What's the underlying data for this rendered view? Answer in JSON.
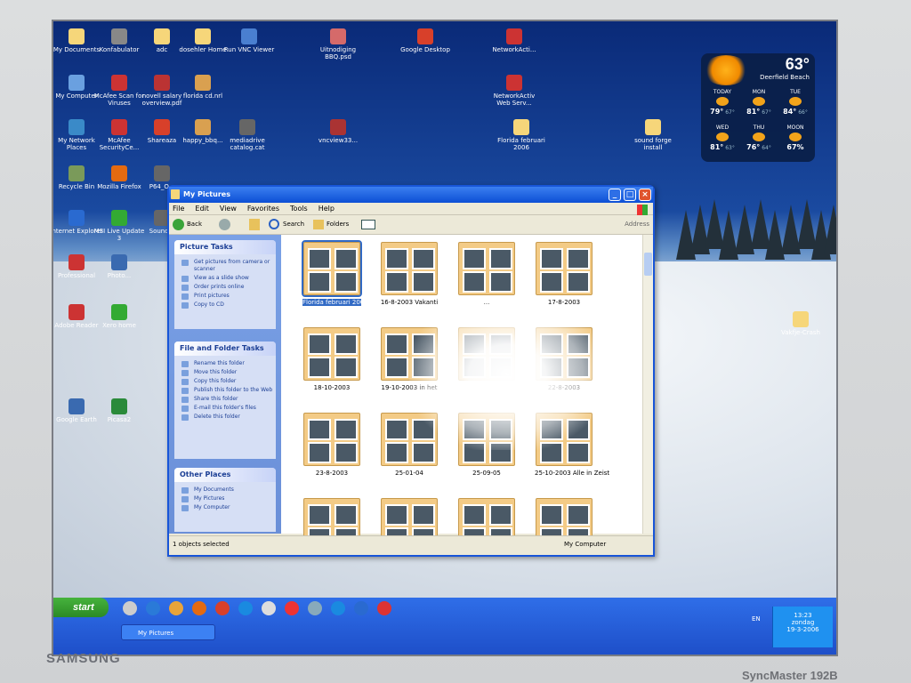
{
  "monitor": {
    "brand": "SAMSUNG",
    "model": "SyncMaster 192B"
  },
  "desktop_icons": [
    {
      "label": "My Documents"
    },
    {
      "label": "Konfabulator"
    },
    {
      "label": "adc"
    },
    {
      "label": "dosehler Home"
    },
    {
      "label": "Run VNC Viewer"
    },
    {
      "label": "Uitnodiging BBQ.psd"
    },
    {
      "label": "Google Desktop"
    },
    {
      "label": "NetworkActi..."
    },
    {
      "label": "My Computer"
    },
    {
      "label": "McAfee Scan for Viruses"
    },
    {
      "label": "novell salary overview.pdf"
    },
    {
      "label": "florida cd.nrl"
    },
    {
      "label": "NetworkActiv Web Serv..."
    },
    {
      "label": "My Network Places"
    },
    {
      "label": "McAfee SecurityCe..."
    },
    {
      "label": "Shareaza"
    },
    {
      "label": "happy_bbq..."
    },
    {
      "label": "mediadrive catalog.cat"
    },
    {
      "label": "vncview33..."
    },
    {
      "label": "Florida februari 2006"
    },
    {
      "label": "sound forge install"
    },
    {
      "label": "Recycle Bin"
    },
    {
      "label": "Mozilla Firefox"
    },
    {
      "label": "P64_O..."
    },
    {
      "label": "Internet Explorer"
    },
    {
      "label": "MSI Live Update 3"
    },
    {
      "label": "Sound..."
    },
    {
      "label": "Professional"
    },
    {
      "label": "Photo..."
    },
    {
      "label": "Adobe Reader"
    },
    {
      "label": "Xero home"
    },
    {
      "label": "Google Earth"
    },
    {
      "label": "Picasa2"
    },
    {
      "label": "Vakfje-Crash"
    }
  ],
  "weather": {
    "temp": "63°",
    "location": "Deerfield Beach",
    "days": [
      {
        "name": "TODAY",
        "hi": "79°",
        "lo": "67°"
      },
      {
        "name": "MON",
        "hi": "81°",
        "lo": "67°"
      },
      {
        "name": "TUE",
        "hi": "84°",
        "lo": "66°"
      },
      {
        "name": "WED",
        "hi": "81°",
        "lo": "63°"
      },
      {
        "name": "THU",
        "hi": "76°",
        "lo": "64°"
      },
      {
        "name": "MOON",
        "hi": "67%",
        "lo": ""
      }
    ]
  },
  "window": {
    "title": "My Pictures",
    "menu": [
      "File",
      "Edit",
      "View",
      "Favorites",
      "Tools",
      "Help"
    ],
    "toolbar": {
      "back": "Back",
      "search": "Search",
      "folders": "Folders",
      "address": "Address"
    },
    "picture_tasks": {
      "title": "Picture Tasks",
      "items": [
        "Get pictures from camera or scanner",
        "View as a slide show",
        "Order prints online",
        "Print pictures",
        "Copy to CD"
      ]
    },
    "file_tasks": {
      "title": "File and Folder Tasks",
      "items": [
        "Rename this folder",
        "Move this folder",
        "Copy this folder",
        "Publish this folder to the Web",
        "Share this folder",
        "E-mail this folder's files",
        "Delete this folder"
      ]
    },
    "other_places": {
      "title": "Other Places",
      "items": [
        "My Documents",
        "My Pictures",
        "My Computer"
      ]
    },
    "folders": [
      {
        "label": "Florida februari 2006",
        "selected": true
      },
      {
        "label": "16-8-2003 Vakanti",
        "selected": false
      },
      {
        "label": "...",
        "selected": false
      },
      {
        "label": "17-8-2003",
        "selected": false
      },
      {
        "label": "18-10-2003",
        "selected": false
      },
      {
        "label": "19-10-2003 in het",
        "selected": false
      },
      {
        "label": "",
        "selected": false
      },
      {
        "label": "22-8-2003",
        "selected": false
      },
      {
        "label": "23-8-2003",
        "selected": false
      },
      {
        "label": "25-01-04",
        "selected": false
      },
      {
        "label": "25-09-05",
        "selected": false
      },
      {
        "label": "25-10-2003 Alle in Zeist",
        "selected": false
      },
      {
        "label": "",
        "selected": false
      },
      {
        "label": "",
        "selected": false
      },
      {
        "label": "",
        "selected": false
      },
      {
        "label": "",
        "selected": false
      }
    ],
    "status_left": "1 objects selected",
    "status_right": "My Computer"
  },
  "taskbar": {
    "start": "start",
    "task": "My Pictures",
    "lang": "EN",
    "time": "13:23",
    "day": "zondag",
    "date": "19-3-2006"
  }
}
